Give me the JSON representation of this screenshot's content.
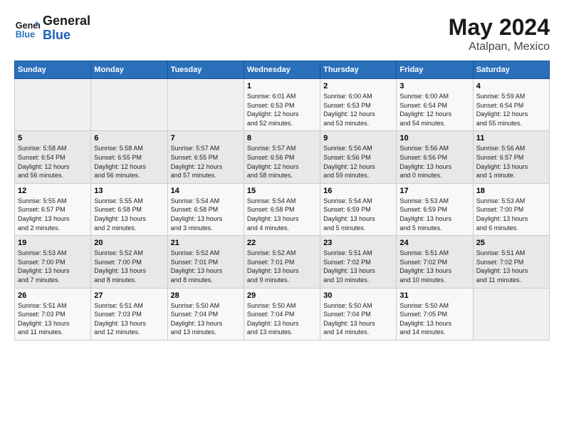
{
  "header": {
    "logo_line1": "General",
    "logo_line2": "Blue",
    "month_year": "May 2024",
    "location": "Atalpan, Mexico"
  },
  "days_of_week": [
    "Sunday",
    "Monday",
    "Tuesday",
    "Wednesday",
    "Thursday",
    "Friday",
    "Saturday"
  ],
  "weeks": [
    [
      {
        "day": "",
        "info": ""
      },
      {
        "day": "",
        "info": ""
      },
      {
        "day": "",
        "info": ""
      },
      {
        "day": "1",
        "info": "Sunrise: 6:01 AM\nSunset: 6:53 PM\nDaylight: 12 hours\nand 52 minutes."
      },
      {
        "day": "2",
        "info": "Sunrise: 6:00 AM\nSunset: 6:53 PM\nDaylight: 12 hours\nand 53 minutes."
      },
      {
        "day": "3",
        "info": "Sunrise: 6:00 AM\nSunset: 6:54 PM\nDaylight: 12 hours\nand 54 minutes."
      },
      {
        "day": "4",
        "info": "Sunrise: 5:59 AM\nSunset: 6:54 PM\nDaylight: 12 hours\nand 55 minutes."
      }
    ],
    [
      {
        "day": "5",
        "info": "Sunrise: 5:58 AM\nSunset: 6:54 PM\nDaylight: 12 hours\nand 56 minutes."
      },
      {
        "day": "6",
        "info": "Sunrise: 5:58 AM\nSunset: 6:55 PM\nDaylight: 12 hours\nand 56 minutes."
      },
      {
        "day": "7",
        "info": "Sunrise: 5:57 AM\nSunset: 6:55 PM\nDaylight: 12 hours\nand 57 minutes."
      },
      {
        "day": "8",
        "info": "Sunrise: 5:57 AM\nSunset: 6:56 PM\nDaylight: 12 hours\nand 58 minutes."
      },
      {
        "day": "9",
        "info": "Sunrise: 5:56 AM\nSunset: 6:56 PM\nDaylight: 12 hours\nand 59 minutes."
      },
      {
        "day": "10",
        "info": "Sunrise: 5:56 AM\nSunset: 6:56 PM\nDaylight: 13 hours\nand 0 minutes."
      },
      {
        "day": "11",
        "info": "Sunrise: 5:56 AM\nSunset: 6:57 PM\nDaylight: 13 hours\nand 1 minute."
      }
    ],
    [
      {
        "day": "12",
        "info": "Sunrise: 5:55 AM\nSunset: 6:57 PM\nDaylight: 13 hours\nand 2 minutes."
      },
      {
        "day": "13",
        "info": "Sunrise: 5:55 AM\nSunset: 6:58 PM\nDaylight: 13 hours\nand 2 minutes."
      },
      {
        "day": "14",
        "info": "Sunrise: 5:54 AM\nSunset: 6:58 PM\nDaylight: 13 hours\nand 3 minutes."
      },
      {
        "day": "15",
        "info": "Sunrise: 5:54 AM\nSunset: 6:58 PM\nDaylight: 13 hours\nand 4 minutes."
      },
      {
        "day": "16",
        "info": "Sunrise: 5:54 AM\nSunset: 6:59 PM\nDaylight: 13 hours\nand 5 minutes."
      },
      {
        "day": "17",
        "info": "Sunrise: 5:53 AM\nSunset: 6:59 PM\nDaylight: 13 hours\nand 5 minutes."
      },
      {
        "day": "18",
        "info": "Sunrise: 5:53 AM\nSunset: 7:00 PM\nDaylight: 13 hours\nand 6 minutes."
      }
    ],
    [
      {
        "day": "19",
        "info": "Sunrise: 5:53 AM\nSunset: 7:00 PM\nDaylight: 13 hours\nand 7 minutes."
      },
      {
        "day": "20",
        "info": "Sunrise: 5:52 AM\nSunset: 7:00 PM\nDaylight: 13 hours\nand 8 minutes."
      },
      {
        "day": "21",
        "info": "Sunrise: 5:52 AM\nSunset: 7:01 PM\nDaylight: 13 hours\nand 8 minutes."
      },
      {
        "day": "22",
        "info": "Sunrise: 5:52 AM\nSunset: 7:01 PM\nDaylight: 13 hours\nand 9 minutes."
      },
      {
        "day": "23",
        "info": "Sunrise: 5:51 AM\nSunset: 7:02 PM\nDaylight: 13 hours\nand 10 minutes."
      },
      {
        "day": "24",
        "info": "Sunrise: 5:51 AM\nSunset: 7:02 PM\nDaylight: 13 hours\nand 10 minutes."
      },
      {
        "day": "25",
        "info": "Sunrise: 5:51 AM\nSunset: 7:02 PM\nDaylight: 13 hours\nand 11 minutes."
      }
    ],
    [
      {
        "day": "26",
        "info": "Sunrise: 5:51 AM\nSunset: 7:03 PM\nDaylight: 13 hours\nand 11 minutes."
      },
      {
        "day": "27",
        "info": "Sunrise: 5:51 AM\nSunset: 7:03 PM\nDaylight: 13 hours\nand 12 minutes."
      },
      {
        "day": "28",
        "info": "Sunrise: 5:50 AM\nSunset: 7:04 PM\nDaylight: 13 hours\nand 13 minutes."
      },
      {
        "day": "29",
        "info": "Sunrise: 5:50 AM\nSunset: 7:04 PM\nDaylight: 13 hours\nand 13 minutes."
      },
      {
        "day": "30",
        "info": "Sunrise: 5:50 AM\nSunset: 7:04 PM\nDaylight: 13 hours\nand 14 minutes."
      },
      {
        "day": "31",
        "info": "Sunrise: 5:50 AM\nSunset: 7:05 PM\nDaylight: 13 hours\nand 14 minutes."
      },
      {
        "day": "",
        "info": ""
      }
    ]
  ]
}
